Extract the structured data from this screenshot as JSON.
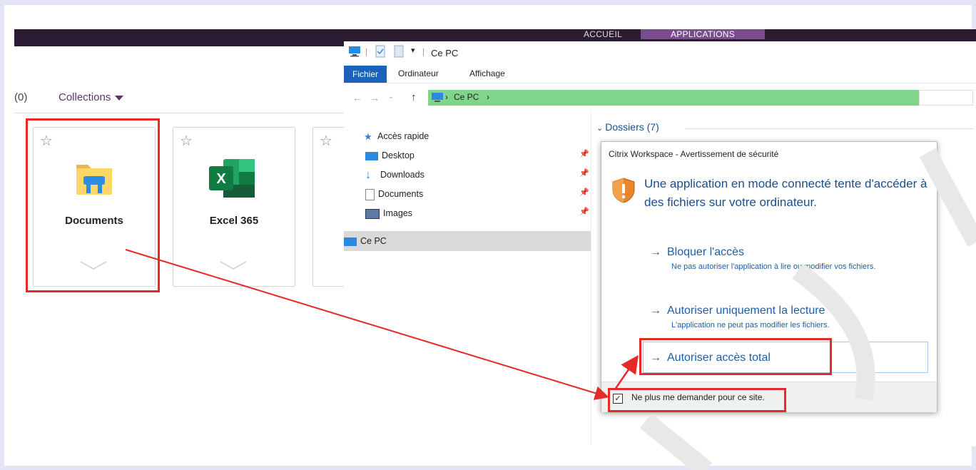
{
  "store": {
    "tabs": [
      "ACCUEIL",
      "APPLICATIONS"
    ],
    "count": "(0)",
    "collections_label": "Collections",
    "apps": [
      {
        "name": "Documents",
        "icon": "folder-icon"
      },
      {
        "name": "Excel 365",
        "icon": "excel-icon"
      }
    ]
  },
  "explorer": {
    "title": "Ce PC",
    "ribbon_tabs": [
      "Fichier",
      "Ordinateur",
      "Affichage"
    ],
    "address_crumb": "Ce PC",
    "nav": {
      "quick_access": "Accès rapide",
      "items": [
        "Desktop",
        "Downloads",
        "Documents",
        "Images"
      ],
      "this_pc": "Ce PC"
    },
    "section_header": "Dossiers (7)"
  },
  "dialog": {
    "title": "Citrix Workspace - Avertissement de sécurité",
    "message": "Une application en mode connecté tente d'accéder à des fichiers sur votre ordinateur.",
    "options": [
      {
        "label": "Bloquer l'accès",
        "sub": "Ne pas autoriser l'application  à lire ou modifier vos fichiers."
      },
      {
        "label": "Autoriser uniquement la lecture",
        "sub": "L'application ne peut pas modifier les fichiers."
      },
      {
        "label": "Autoriser accès total",
        "sub": ""
      }
    ],
    "checkbox_label": "Ne plus me demander pour ce site.",
    "checkbox_checked": true
  },
  "colors": {
    "annotation": "#e52a2a",
    "link": "#1b5fab",
    "accent": "#7a4e8c"
  }
}
